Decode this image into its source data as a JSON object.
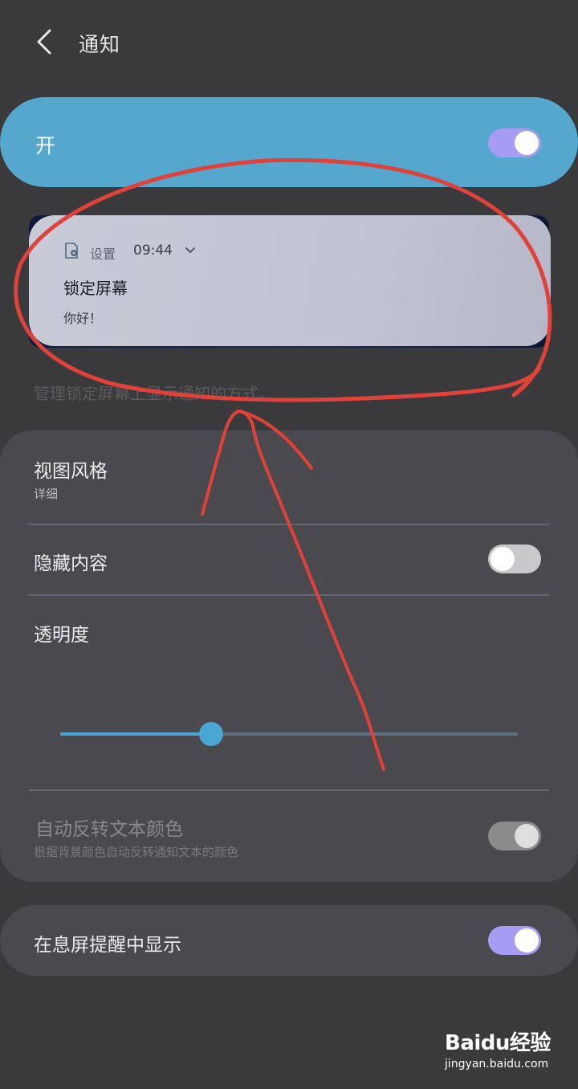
{
  "header": {
    "title": "通知"
  },
  "master": {
    "label": "开",
    "on": true
  },
  "preview": {
    "app_name": "设置",
    "time": "09:44",
    "title": "锁定屏幕",
    "text": "你好！"
  },
  "description": "管理锁定屏幕上显示通知的方式。",
  "settings": {
    "view_style": {
      "label": "视图风格",
      "value": "详细"
    },
    "hide_content": {
      "label": "隐藏内容",
      "on": false
    },
    "transparency": {
      "label": "透明度",
      "level": 0.33
    },
    "auto_invert": {
      "label": "自动反转文本颜色",
      "description": "根据背景颜色自动反转通知文本的颜色",
      "on": true,
      "enabled": false
    }
  },
  "aod": {
    "label": "在息屏提醒中显示",
    "on": true
  },
  "watermark": {
    "brand": "Bai",
    "brand_suffix": "经验",
    "paw": "du",
    "url": "jingyan.baidu.com"
  },
  "colors": {
    "accent": "#56a7cd",
    "toggle_on": "#a79cf3",
    "background": "#3a3a3c",
    "annotation": "#e0423a"
  }
}
